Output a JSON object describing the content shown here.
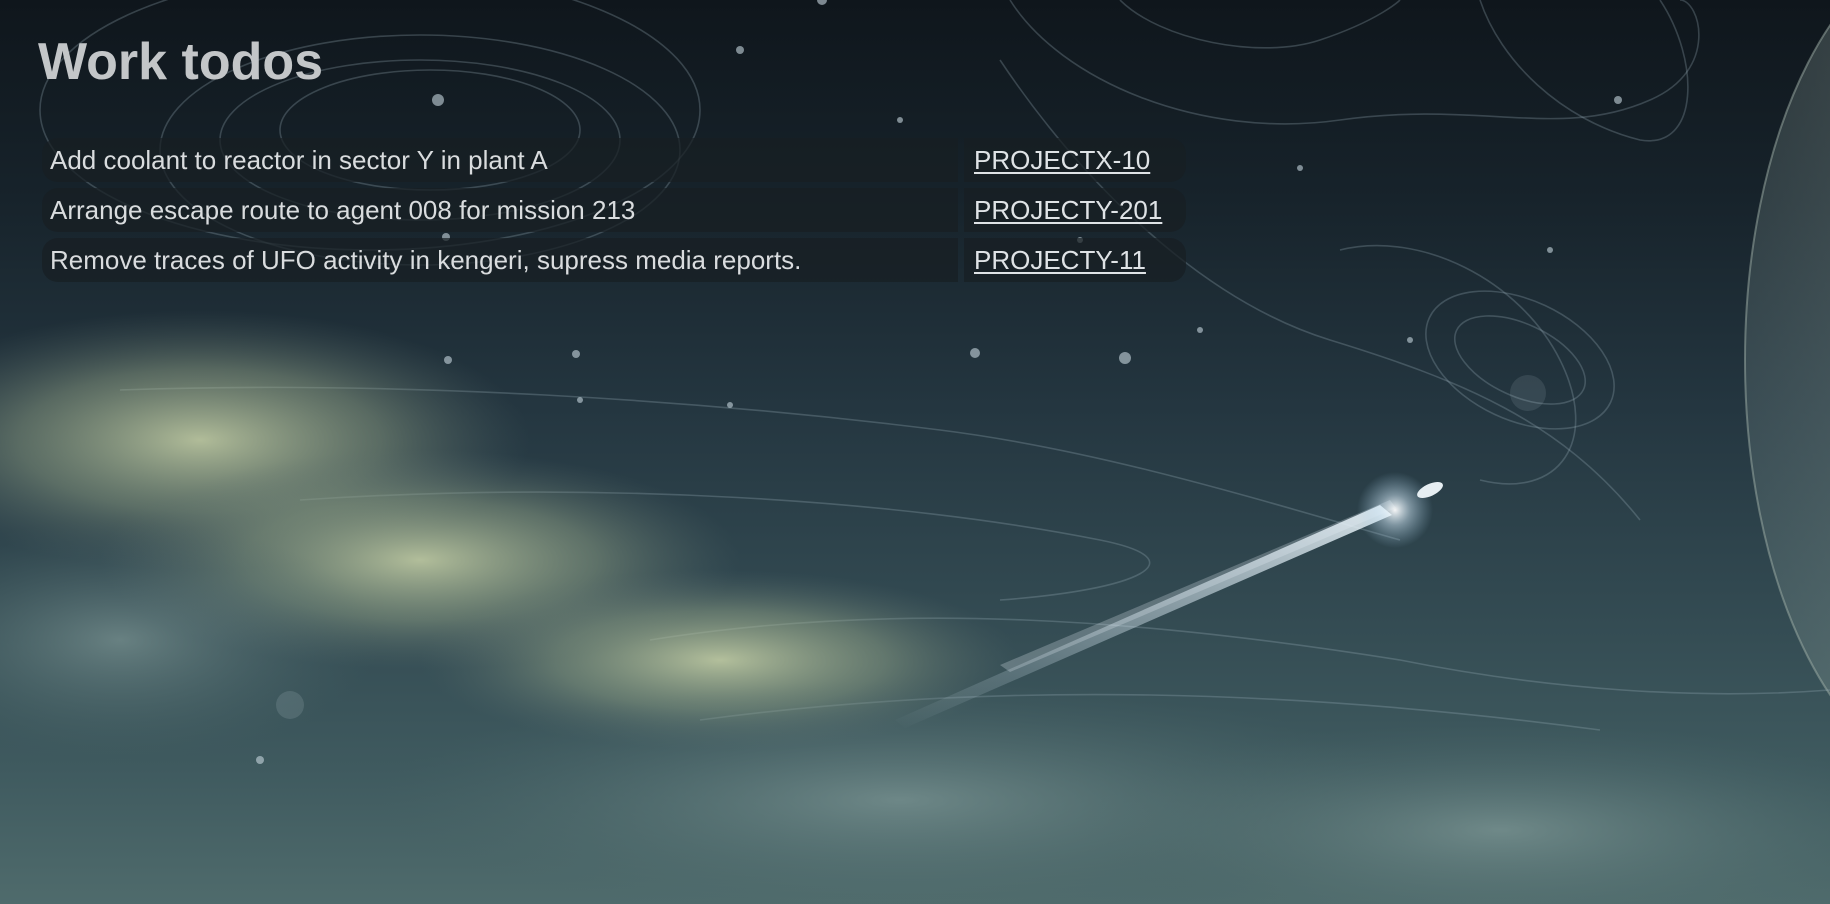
{
  "page": {
    "title": "Work todos"
  },
  "todos": [
    {
      "task": "Add coolant to reactor in sector Y in plant A",
      "key": "PROJECTX-10"
    },
    {
      "task": "Arrange escape route to agent 008 for mission 213",
      "key": "PROJECTY-201"
    },
    {
      "task": "Remove traces of UFO activity in kengeri, supress media reports.",
      "key": "PROJECTY-11"
    }
  ],
  "colors": {
    "title": "#c3c6c8",
    "row_background": "#181e22",
    "text": "#d9dcde",
    "link": "#dfe3e6"
  },
  "background": {
    "description_icon": "space-wallpaper"
  }
}
